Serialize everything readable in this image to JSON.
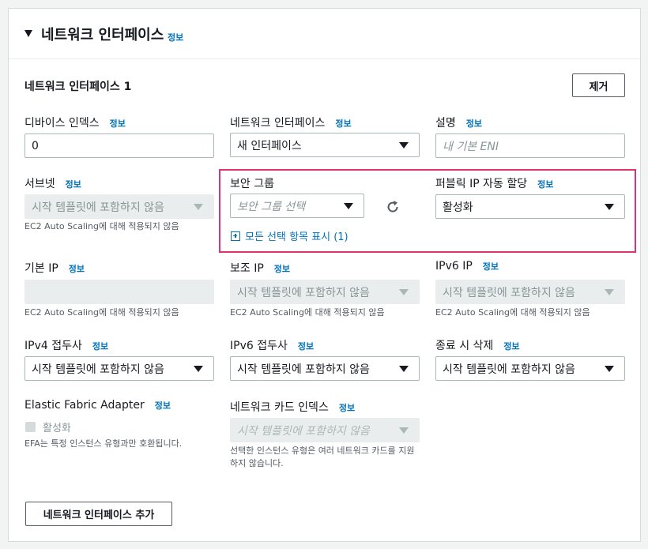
{
  "header": {
    "title": "네트워크 인터페이스",
    "info": "정보"
  },
  "card": {
    "title": "네트워크 인터페이스 1",
    "remove_label": "제거"
  },
  "fields": {
    "device_index": {
      "label": "디바이스 인덱스",
      "info": "정보",
      "value": "0"
    },
    "network_interface": {
      "label": "네트워크 인터페이스",
      "info": "정보",
      "value": "새 인터페이스"
    },
    "description": {
      "label": "설명",
      "info": "정보",
      "placeholder": "내 기본 ENI"
    },
    "subnet": {
      "label": "서브넷",
      "info": "정보",
      "value": "시작 템플릿에 포함하지 않음",
      "help": "EC2 Auto Scaling에 대해 적용되지 않음"
    },
    "security_group": {
      "label": "보안 그룹",
      "placeholder": "보안 그룹 선택",
      "show_all": "모든 선택 항목 표시 (1)"
    },
    "public_ip": {
      "label": "퍼블릭 IP 자동 할당",
      "info": "정보",
      "value": "활성화"
    },
    "primary_ip": {
      "label": "기본 IP",
      "info": "정보",
      "help": "EC2 Auto Scaling에 대해 적용되지 않음"
    },
    "secondary_ip": {
      "label": "보조 IP",
      "info": "정보",
      "value": "시작 템플릿에 포함하지 않음",
      "help": "EC2 Auto Scaling에 대해 적용되지 않음"
    },
    "ipv6_ip": {
      "label": "IPv6 IP",
      "info": "정보",
      "value": "시작 템플릿에 포함하지 않음",
      "help": "EC2 Auto Scaling에 대해 적용되지 않음"
    },
    "ipv4_prefix": {
      "label": "IPv4 접두사",
      "info": "정보",
      "value": "시작 템플릿에 포함하지 않음"
    },
    "ipv6_prefix": {
      "label": "IPv6 접두사",
      "info": "정보",
      "value": "시작 템플릿에 포함하지 않음"
    },
    "delete_on_termination": {
      "label": "종료 시 삭제",
      "info": "정보",
      "value": "시작 템플릿에 포함하지 않음"
    },
    "efa": {
      "label": "Elastic Fabric Adapter",
      "info": "정보",
      "checkbox_label": "활성화",
      "help": "EFA는 특정 인스턴스 유형과만 호환됩니다."
    },
    "network_card_index": {
      "label": "네트워크 카드 인덱스",
      "info": "정보",
      "value": "시작 템플릿에 포함하지 않음",
      "help_line1": "선택한 인스턴스 유형은 여러 네트워크 카드를 지원",
      "help_line2": "하지 않습니다."
    }
  },
  "add_button_label": "네트워크 인터페이스 추가",
  "colors": {
    "link": "#0073bb",
    "highlight": "#e0336e",
    "disabled_bg": "#eaeded"
  },
  "icons": [
    "caret-down-icon",
    "refresh-icon",
    "plus-square-icon",
    "checkbox-icon"
  ]
}
